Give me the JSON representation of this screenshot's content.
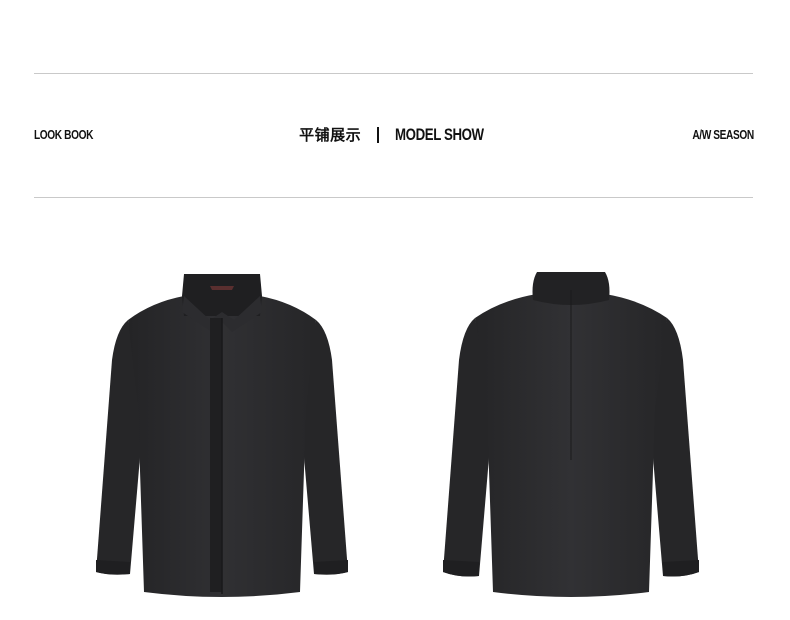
{
  "header": {
    "left_label": "LOOK BOOK",
    "center_cn": "平铺展示",
    "center_en": "MODEL SHOW",
    "right_label": "A/W SEASON"
  },
  "images": {
    "front": "jacket-front-view",
    "back": "jacket-back-view"
  },
  "colors": {
    "rule": "#c9c9c9",
    "text": "#111111",
    "garment": "#2b2b2d"
  }
}
